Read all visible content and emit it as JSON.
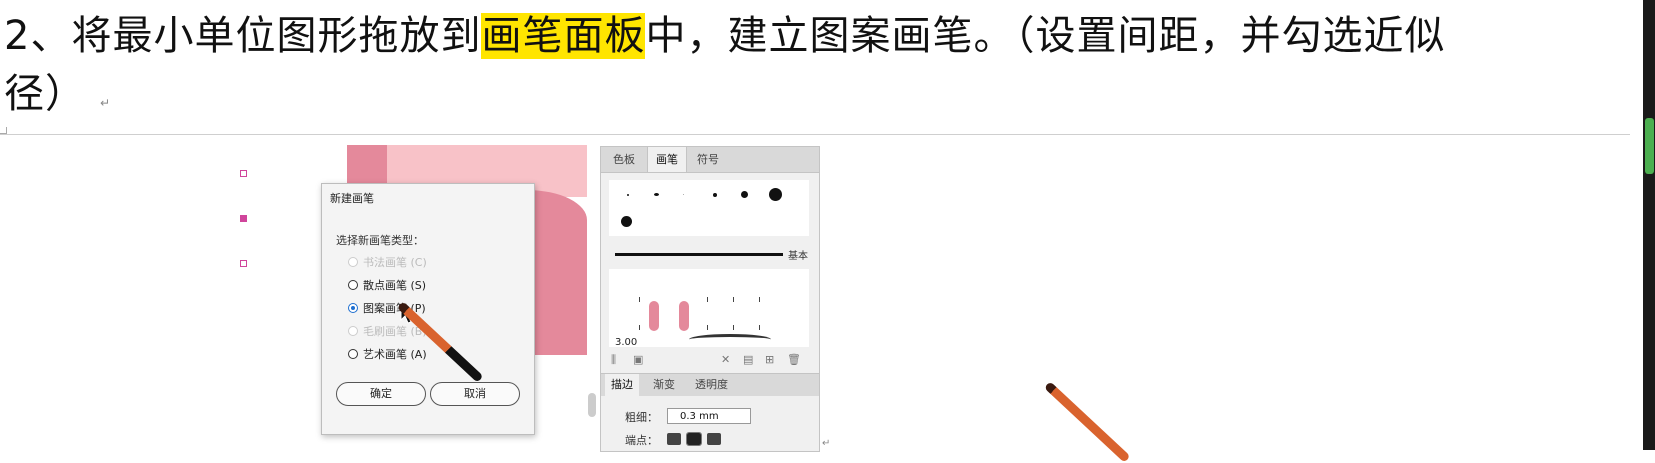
{
  "doc": {
    "line1_before": "2、将最小单位图形拖放到",
    "line1_highlight": "画笔面板",
    "line1_after": "中，建立图案画笔。（设置间距，并勾选近似",
    "line2": "径）",
    "para_mark": "↵"
  },
  "dialog": {
    "title": "新建画笔",
    "prompt": "选择新画笔类型：",
    "options": [
      {
        "label": "书法画笔 (C)",
        "enabled": false,
        "selected": false
      },
      {
        "label": "散点画笔 (S)",
        "enabled": true,
        "selected": false
      },
      {
        "label": "图案画笔 (P)",
        "enabled": true,
        "selected": true
      },
      {
        "label": "毛刷画笔 (B)",
        "enabled": false,
        "selected": false
      },
      {
        "label": "艺术画笔 (A)",
        "enabled": true,
        "selected": false
      }
    ],
    "ok_label": "确定",
    "cancel_label": "取消"
  },
  "panel": {
    "tabs": [
      "色板",
      "画笔",
      "符号"
    ],
    "active_tab": "画笔",
    "basic_label": "基本",
    "size_value": "3.00",
    "stroke_tabs": [
      "描边",
      "渐变",
      "透明度"
    ],
    "weight_label": "粗细：",
    "weight_value": "0.3 mm",
    "cap_label": "端点："
  },
  "colors": {
    "highlight": "#ffe500",
    "pink_dark": "#e4899b",
    "pink_light": "#f8c2c8",
    "radio_selected": "#1e6fd0",
    "scroll_thumb": "#4caf50"
  }
}
